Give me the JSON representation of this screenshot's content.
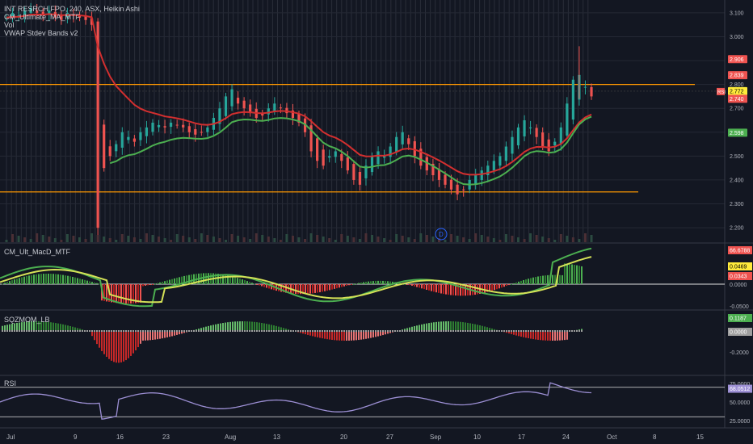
{
  "header": {
    "symbol_line": "INT RESRCH FPO, 240, ASX, Heikin Ashi",
    "indicator_1": "CM_Ultimate_MA_MTF",
    "indicator_2": "Vol",
    "indicator_3": "VWAP Stdev Bands v2"
  },
  "panes": {
    "macd_title": "CM_Ult_MacD_MTF",
    "squeeze_title": "SQZMOM_LB",
    "rsi_title": "RSI"
  },
  "badge": "D",
  "colors": {
    "background": "#131722",
    "up": "#26a69a",
    "bull": "#4caf50",
    "bear": "#ef5350",
    "ma_red": "#d32f2f",
    "ma_green": "#4caf50",
    "orange": "#ff9800",
    "macd_yellow": "#d4e157",
    "rsi": "#9c8fd4"
  },
  "chart_data": [
    {
      "type": "candlestick",
      "title": "INT RESRCH FPO, 240, ASX, Heikin Ashi",
      "y_axis_ticks": [
        "3.100",
        "3.000",
        "2.900",
        "2.800",
        "2.700",
        "2.600",
        "2.500",
        "2.400",
        "2.300",
        "2.200"
      ],
      "ylim": [
        2.18,
        3.12
      ],
      "x_axis_ticks": [
        "Jul",
        "9",
        "16",
        "23",
        "Aug",
        "13",
        "20",
        "27",
        "Sep",
        "10",
        "17",
        "24",
        "Oct",
        "8",
        "15"
      ],
      "horizontal_levels": [
        2.8,
        2.35
      ],
      "price_tags": [
        {
          "label": "2.906",
          "value": 2.906,
          "color": "#ef5350"
        },
        {
          "label": "2.839",
          "value": 2.839,
          "color": "#ef5350"
        },
        {
          "label": "2.772",
          "value": 2.772,
          "color": "#ffeb3b"
        },
        {
          "label": "2.740",
          "value": 2.74,
          "color": "#ef5350"
        },
        {
          "label": "2.598",
          "value": 2.598,
          "color": "#4caf50"
        }
      ],
      "side_tag": "RSI",
      "close_series": [
        3.08,
        3.1,
        3.09,
        3.11,
        3.12,
        3.1,
        3.09,
        3.11,
        3.08,
        3.07,
        3.1,
        3.09,
        3.08,
        3.07,
        3.05,
        2.2,
        2.45,
        2.5,
        2.55,
        2.6,
        2.58,
        2.56,
        2.6,
        2.62,
        2.64,
        2.63,
        2.62,
        2.64,
        2.63,
        2.62,
        2.6,
        2.59,
        2.6,
        2.62,
        2.66,
        2.7,
        2.75,
        2.78,
        2.72,
        2.7,
        2.68,
        2.66,
        2.67,
        2.7,
        2.72,
        2.7,
        2.68,
        2.66,
        2.64,
        2.6,
        2.52,
        2.48,
        2.46,
        2.5,
        2.52,
        2.48,
        2.44,
        2.4,
        2.38,
        2.46,
        2.5,
        2.52,
        2.5,
        2.54,
        2.58,
        2.6,
        2.55,
        2.5,
        2.46,
        2.44,
        2.42,
        2.4,
        2.38,
        2.36,
        2.34,
        2.36,
        2.4,
        2.42,
        2.44,
        2.46,
        2.48,
        2.5,
        2.54,
        2.58,
        2.62,
        2.65,
        2.62,
        2.58,
        2.54,
        2.52,
        2.56,
        2.62,
        2.72,
        2.82,
        2.84,
        2.79,
        2.75
      ]
    },
    {
      "type": "bar",
      "title": "CM_Ult_MacD_MTF",
      "y_axis_ticks": [
        "0.0000",
        "-0.0500"
      ],
      "value_tags": [
        {
          "label": "66.6788",
          "color": "#ef5350"
        },
        {
          "label": "0.0469",
          "color": "#ffeb3b"
        },
        {
          "label": "0.0343",
          "color": "#ef5350"
        }
      ]
    },
    {
      "type": "bar",
      "title": "SQZMOM_LB",
      "y_axis_ticks": [
        "0.0000",
        "-0.2000"
      ],
      "value_tags": [
        {
          "label": "0.1187",
          "color": "#4caf50"
        },
        {
          "label": "0.0000",
          "color": "#9e9e9e"
        }
      ]
    },
    {
      "type": "line",
      "title": "RSI",
      "y_axis_ticks": [
        "75.0000",
        "50.0000",
        "25.0000"
      ],
      "ylim": [
        15,
        85
      ],
      "bands": [
        70,
        30
      ],
      "value_tags": [
        {
          "label": "68.0512",
          "color": "#9c8fd4"
        }
      ]
    }
  ]
}
